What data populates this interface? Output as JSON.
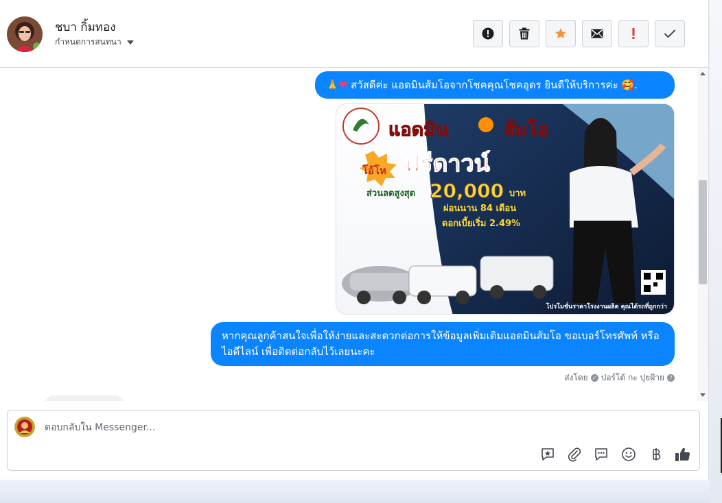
{
  "contact": {
    "name": "ชบา กิ้มทอง",
    "assign_label": "กำหนดการสนทนา"
  },
  "toolbar": {
    "buttons": [
      {
        "name": "spam-button",
        "icon": "alert-circle-icon"
      },
      {
        "name": "delete-button",
        "icon": "trash-icon"
      },
      {
        "name": "star-button",
        "icon": "star-icon",
        "color": "#f7923b"
      },
      {
        "name": "mark-unread-button",
        "icon": "envelope-icon"
      },
      {
        "name": "follow-up-button",
        "icon": "exclamation-icon",
        "color": "#e4322b"
      },
      {
        "name": "mark-done-button",
        "icon": "check-icon"
      }
    ]
  },
  "messages": {
    "greeting": "สวัสดีค่ะ แอดมินส้มโอจากโชคคุณโชคอุดร ยินดีให้บริการค่ะ",
    "greeting_end": ".",
    "followup": "หากคุณลูกค้าสนใจเพื่อให้ง่ายและสะดวกต่อการให้ข้อมูลเพิ่มเติมแอดมินส้มโอ ขอเบอร์โทรศัพท์ หรือ ไอดีไลน์ เพื่อติดต่อกลับไว้เลยนะคะ",
    "sent_by_label": "ส่งโดย",
    "sent_by_name": "ปอร์โต้ กะ ปุยฝ้าย"
  },
  "promo_image": {
    "brand_line1": "แอดมิน",
    "brand_line2": "ส้มโอ",
    "offer_badge": "โอ้โห",
    "headline": "ฟรีดาวน์",
    "discount_label": "ส่วนลดสูงสุด",
    "discount_amount": "20,000",
    "discount_unit": "บาท",
    "installment": "ผ่อนนาน 84 เดือน",
    "interest": "ดอกเบี้ยเริ่ม 2.49%",
    "footer": "โปรโมชั่นราคาโรงงานผลิต คุณได้รถที่ถูกกว่า"
  },
  "composer": {
    "placeholder": "ตอบกลับใน Messenger...",
    "icons": [
      "saved-reply-icon",
      "attachment-icon",
      "chat-bubble-icon",
      "emoji-icon",
      "baht-icon",
      "thumbs-up-icon"
    ]
  },
  "colors": {
    "accent": "#0b84ff",
    "star": "#f7923b",
    "alert": "#e4322b"
  }
}
